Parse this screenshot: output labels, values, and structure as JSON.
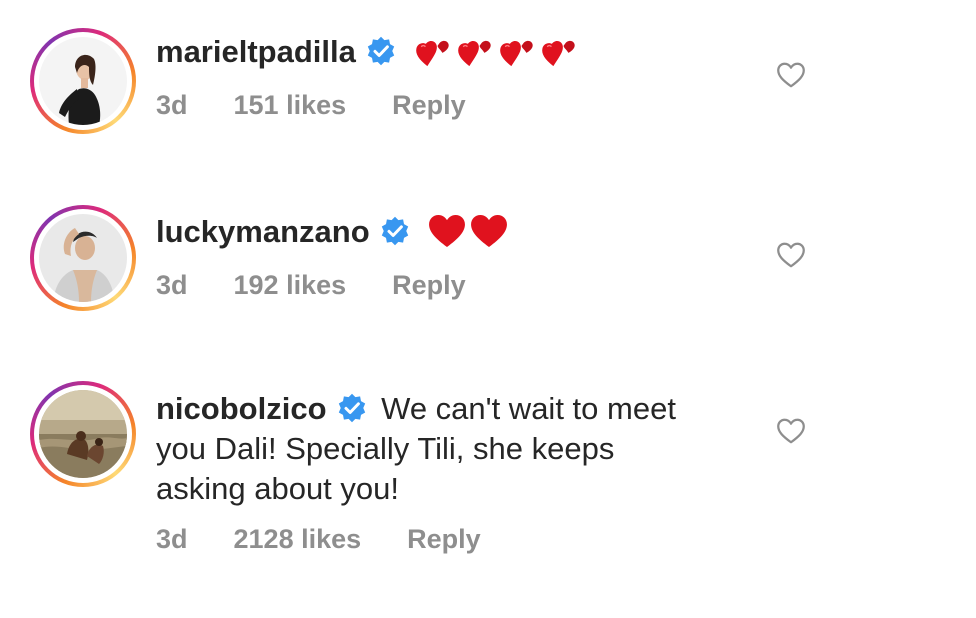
{
  "comments": [
    {
      "username": "marieltpadilla",
      "text": "",
      "emoji": "two-hearts x4",
      "time": "3d",
      "likes": "151 likes",
      "reply": "Reply"
    },
    {
      "username": "luckymanzano",
      "text": "",
      "emoji": "red-heart x2",
      "time": "3d",
      "likes": "192 likes",
      "reply": "Reply"
    },
    {
      "username": "nicobolzico",
      "text_line1": "We can't wait to meet",
      "text_line2": "you Dali! Specially Tili, she keeps",
      "text_line3": "asking about you!",
      "time": "3d",
      "likes": "2128 likes",
      "reply": "Reply"
    }
  ],
  "colors": {
    "verified_blue": "#3897f0",
    "heart_red": "#e0121e",
    "meta_gray": "#8e8e8e",
    "text": "#262626"
  }
}
